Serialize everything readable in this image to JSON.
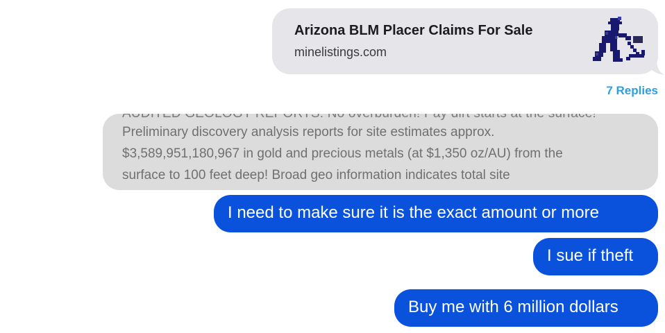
{
  "link_preview": {
    "title": "Arizona BLM Placer Claims For Sale",
    "domain": "minelistings.com",
    "thumbnail_icon": "miner-icon"
  },
  "thread": {
    "replies_label": "7 Replies"
  },
  "quoted_message": {
    "clipped_line": "AUDITED GEOLOGY REPORTS: No overburden! Pay dirt starts at the surface!",
    "lines": [
      "Preliminary discovery analysis reports for site estimates approx.",
      "$3,589,951,180,967 in gold and precious metals (at $1,350 oz/AU) from the",
      "surface to 100 feet deep! Broad geo information indicates total site"
    ]
  },
  "messages": [
    {
      "text": "I need to make sure it is the exact amount or more"
    },
    {
      "text": "I sue if theft"
    },
    {
      "text": "Buy me with 6 million dollars"
    }
  ],
  "colors": {
    "sent_bubble": "#0a52dc",
    "received_bubble": "#e5e5ea",
    "quote_bubble": "#dcdcdc",
    "replies_link": "#2d9ee0"
  }
}
